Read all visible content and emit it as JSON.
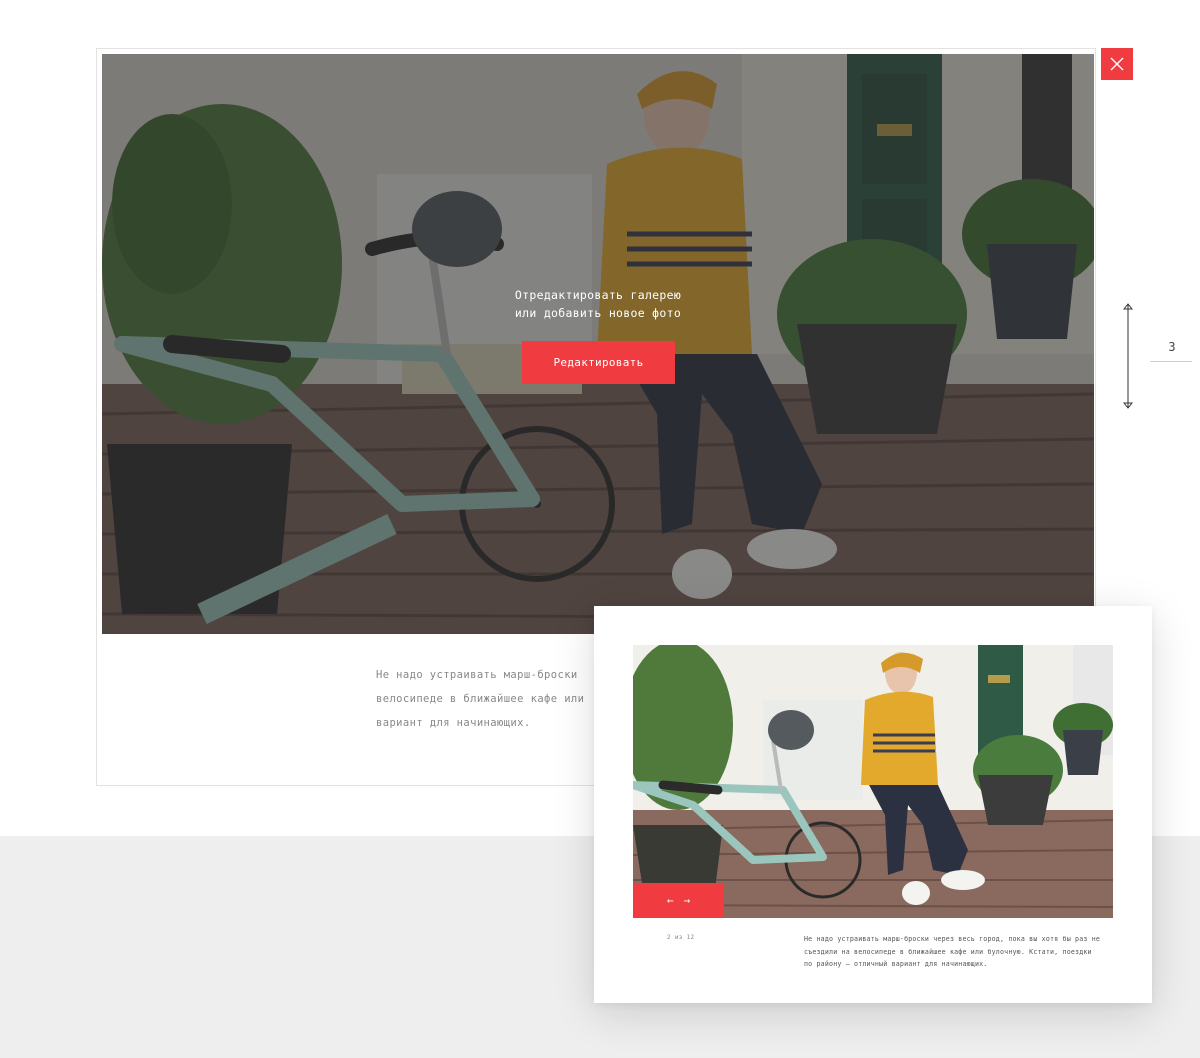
{
  "editor": {
    "overlay_line1": "Отредактировать галерею",
    "overlay_line2": "или добавить новое фото",
    "edit_button_label": "Редактировать",
    "caption_line1": "Не надо устраивать марш-броски",
    "caption_line2": "велосипеде в ближайшее кафе или",
    "caption_line3": "вариант для начинающих."
  },
  "height_indicator": {
    "value": "3"
  },
  "preview": {
    "prev_arrow": "←",
    "next_arrow": "→",
    "counter": "2 из 12",
    "caption": "Не надо устраивать марш-броски через весь город, пока вы хотя бы раз не съездили на велосипеде в ближайшее кафе или булочную. Кстати, поездки по району – отличный вариант для начинающих."
  },
  "colors": {
    "accent": "#f03c41",
    "bottom_band": "#eeeeee"
  },
  "icons": {
    "close": "close-icon",
    "resize": "vertical-resize-icon"
  }
}
